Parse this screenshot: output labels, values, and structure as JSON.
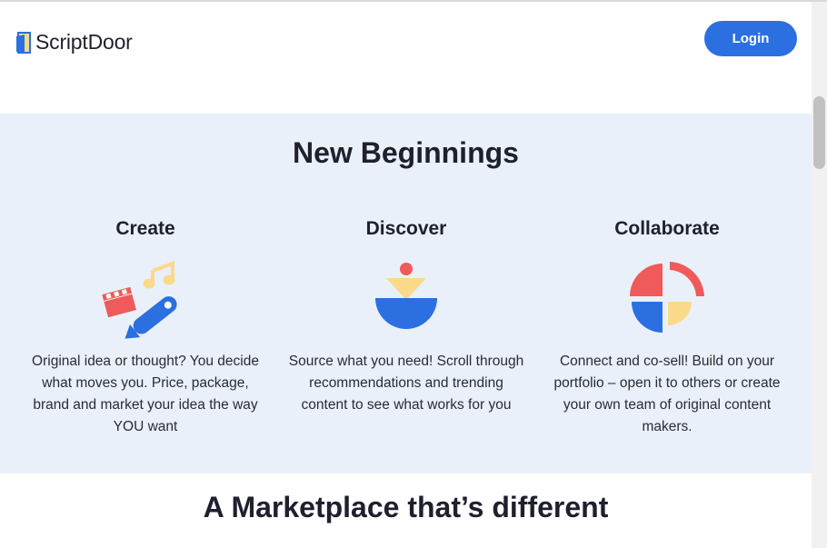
{
  "header": {
    "brand": "ScriptDoor",
    "login_label": "Login"
  },
  "section": {
    "title": "New Beginnings",
    "columns": [
      {
        "heading": "Create",
        "text": "Original idea or thought? You decide what moves you. Price, package, brand and market your idea the way YOU want",
        "icon": "clapper-music-pen-icon"
      },
      {
        "heading": "Discover",
        "text": "Source what you need! Scroll through recommendations and trending content to see what works for you",
        "icon": "discover-shapes-icon"
      },
      {
        "heading": "Collaborate",
        "text": "Connect and co-sell! Build on your portfolio – open it to others or create your own team of original content makers.",
        "icon": "collaborate-pie-icon"
      }
    ]
  },
  "bottom": {
    "title": "A Marketplace that’s different"
  },
  "colors": {
    "accent": "#2b6fe0",
    "section_bg": "#e9f0fa",
    "red": "#f05a5a",
    "yellow": "#fbd98a",
    "blue": "#2b6fe0"
  }
}
